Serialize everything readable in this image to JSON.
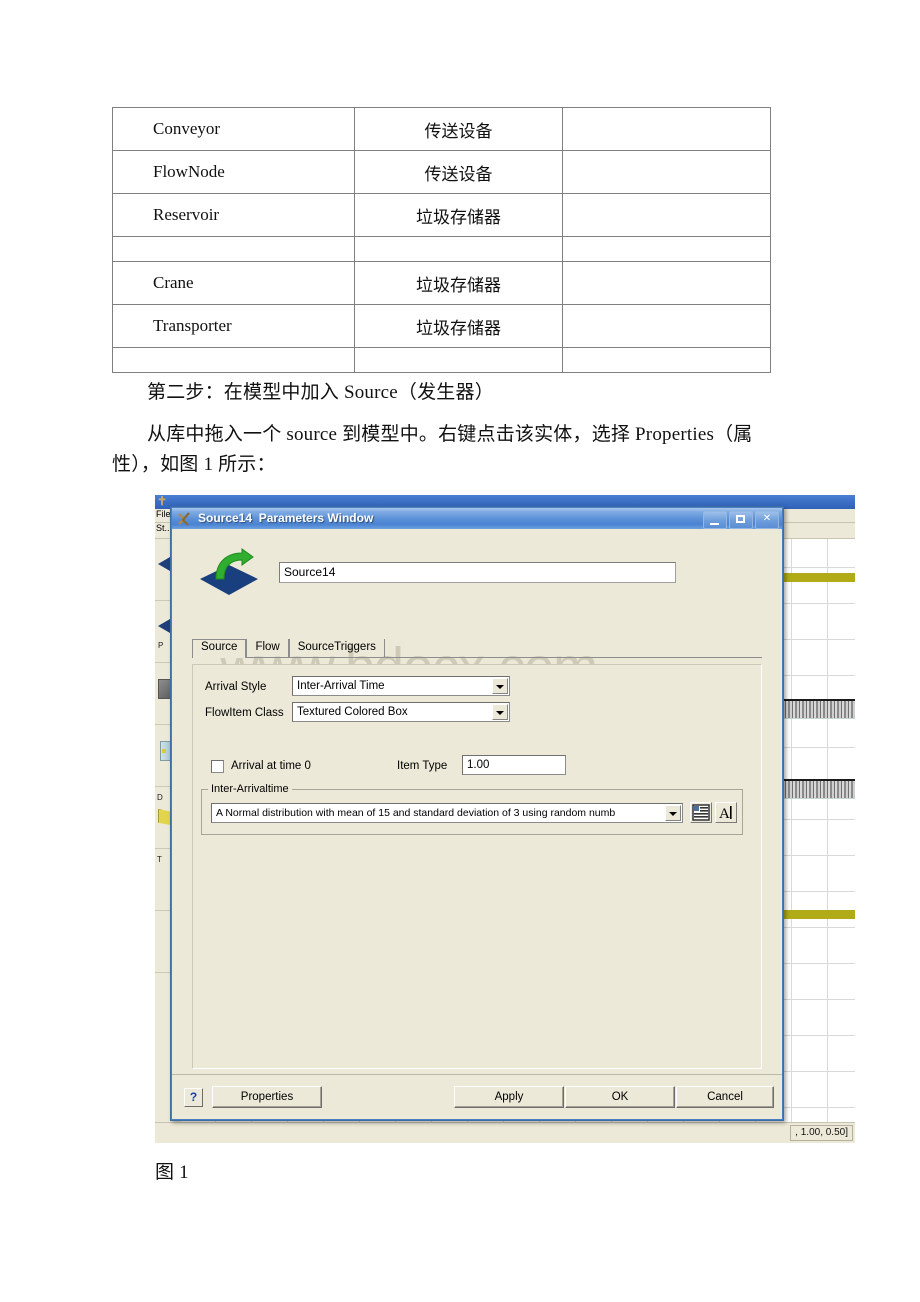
{
  "document": {
    "table": {
      "rows": [
        {
          "name": "Conveyor",
          "cn": "传送设备",
          "note": ""
        },
        {
          "name": "FlowNode",
          "cn": "传送设备",
          "note": ""
        },
        {
          "name": "Reservoir",
          "cn": "垃圾存储器",
          "note": ""
        },
        {
          "name": "",
          "cn": "",
          "note": ""
        },
        {
          "name": "Crane",
          "cn": "垃圾存储器",
          "note": ""
        },
        {
          "name": "Transporter",
          "cn": "垃圾存储器",
          "note": ""
        },
        {
          "name": "",
          "cn": "",
          "note": ""
        }
      ]
    },
    "paragraphs": {
      "step2": "第二步：在模型中加入 Source（发生器）",
      "description": "从库中拖入一个 source 到模型中。右键点击该实体，选择 Properties（属性），如图 1 所示："
    },
    "figure_caption": "图 1"
  },
  "screenshot": {
    "background_app": {
      "menu_text": "File",
      "toolbar_text": "St...",
      "dock_items": [
        {
          "label": ""
        },
        {
          "label": "P"
        },
        {
          "label": ""
        },
        {
          "label": ""
        },
        {
          "label": "D"
        },
        {
          "label": "T"
        }
      ],
      "status_text": ", 1.00, 0.50]"
    },
    "dialog": {
      "title": "Source14  Parameters Window",
      "title_icon": "flexsim-icon",
      "window_buttons": {
        "minimize": "minimize-button",
        "maximize": "maximize-button",
        "close": "close-button"
      },
      "object_icon": "source-object-icon",
      "name_value": "Source14",
      "watermark": "www.bdocx.com",
      "tabs": [
        {
          "label": "Source",
          "active": true
        },
        {
          "label": "Flow",
          "active": false
        },
        {
          "label": "SourceTriggers",
          "active": false
        }
      ],
      "fields": {
        "arrival_style_label": "Arrival Style",
        "arrival_style_value": "Inter-Arrival Time",
        "flowitem_class_label": "FlowItem Class",
        "flowitem_class_value": "Textured Colored Box",
        "arrival_at_time_zero_label": "Arrival at time 0",
        "arrival_at_time_zero_checked": false,
        "item_type_label": "Item Type",
        "item_type_value": "1.00"
      },
      "group": {
        "title": "Inter-Arrivaltime",
        "distribution_value": "A Normal distribution with mean of 15   and standard deviation of 3   using random numb",
        "edit_button": "form-editor-button",
        "code_button": "code-editor-button"
      },
      "footer": {
        "help_label": "?",
        "properties_label": "Properties",
        "apply_label": "Apply",
        "ok_label": "OK",
        "cancel_label": "Cancel"
      }
    }
  },
  "colors": {
    "title_blue": "#4b83d2",
    "dialog_face": "#ece9d8",
    "icon_blue": "#1a3f7e",
    "icon_green": "#2fae2f",
    "model_yellow": "#b0ab16"
  }
}
